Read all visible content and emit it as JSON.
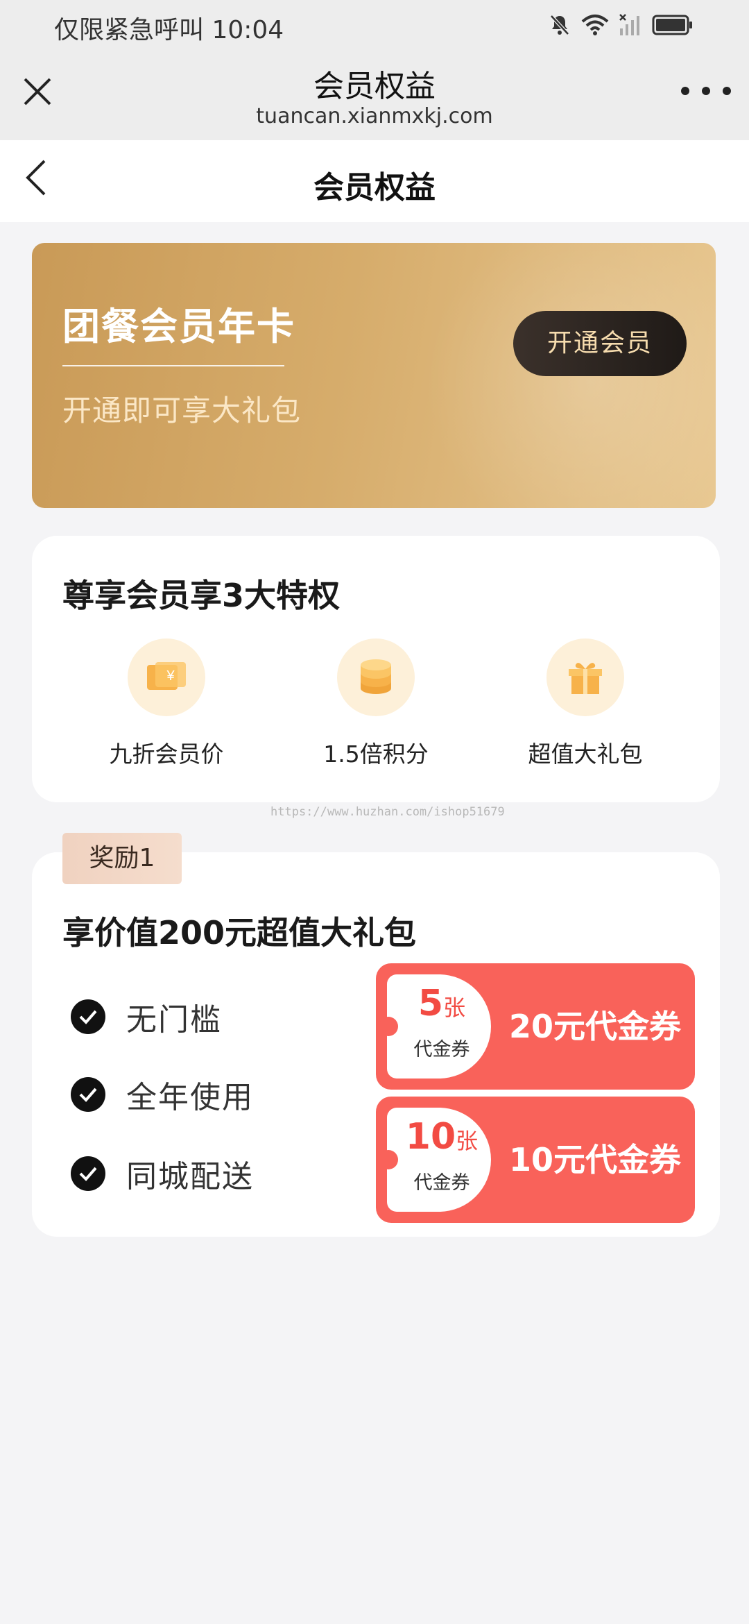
{
  "status_bar": {
    "text": "仅限紧急呼叫 10:04"
  },
  "browser": {
    "title": "会员权益",
    "url": "tuancan.xianmxkj.com"
  },
  "nav": {
    "title": "会员权益"
  },
  "member_card": {
    "title": "团餐会员年卡",
    "subtitle": "开通即可享大礼包",
    "button": "开通会员",
    "colors": {
      "gradient_start": "#c99a57",
      "gradient_end": "#e8c892",
      "button_bg": "#2a231f",
      "button_text": "#f6dcae"
    }
  },
  "privileges": {
    "title": "尊享会员享3大特权",
    "items": [
      {
        "label": "九折会员价",
        "icon": "ticket-yuan-icon"
      },
      {
        "label": "1.5倍积分",
        "icon": "coin-stack-icon"
      },
      {
        "label": "超值大礼包",
        "icon": "gift-box-icon"
      }
    ]
  },
  "watermark": "https://www.huzhan.com/ishop51679",
  "reward": {
    "tag": "奖励1",
    "title": "享价值200元超值大礼包",
    "features": [
      "无门槛",
      "全年使用",
      "同城配送"
    ],
    "coupons": [
      {
        "count": "5",
        "unit": "张",
        "type": "代金券",
        "label": "20元代金券"
      },
      {
        "count": "10",
        "unit": "张",
        "type": "代金券",
        "label": "10元代金券"
      }
    ],
    "coupon_color": "#f9625a"
  }
}
